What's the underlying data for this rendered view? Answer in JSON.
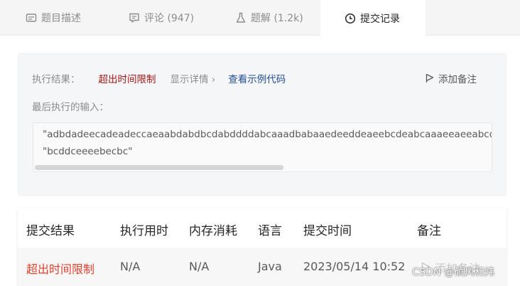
{
  "tabs": [
    {
      "label": "题目描述",
      "icon": "description-icon"
    },
    {
      "label": "评论 (947)",
      "icon": "comment-icon"
    },
    {
      "label": "题解 (1.2k)",
      "icon": "flask-icon"
    },
    {
      "label": "提交记录",
      "icon": "clock-icon",
      "active": true
    }
  ],
  "result": {
    "label": "执行结果：",
    "status": "超出时间限制",
    "show_detail": "显示详情 ›",
    "view_example": "查看示例代码",
    "add_note": "添加备注",
    "last_input_label": "最后执行的输入：",
    "input_line1": "\"adbdadeecadeadeccaeaabdabdbcdabddddabcaaadbabaaedeeddeaeebcdeabcaaaeeaeeabcddc",
    "input_line2": "\"bcddceeeebecbc\""
  },
  "table": {
    "headers": [
      "提交结果",
      "执行用时",
      "内存消耗",
      "语言",
      "提交时间",
      "备注"
    ],
    "rows": [
      {
        "result": "超出时间限制",
        "time": "N/A",
        "memory": "N/A",
        "language": "Java",
        "submitted": "2023/05/14 10:52",
        "note": "添加备注"
      }
    ]
  },
  "watermark": "CSDN @硕风和炜",
  "colors": {
    "status_red": "#a31515",
    "row_red": "#e0402c",
    "link_blue": "#1f4e99"
  }
}
